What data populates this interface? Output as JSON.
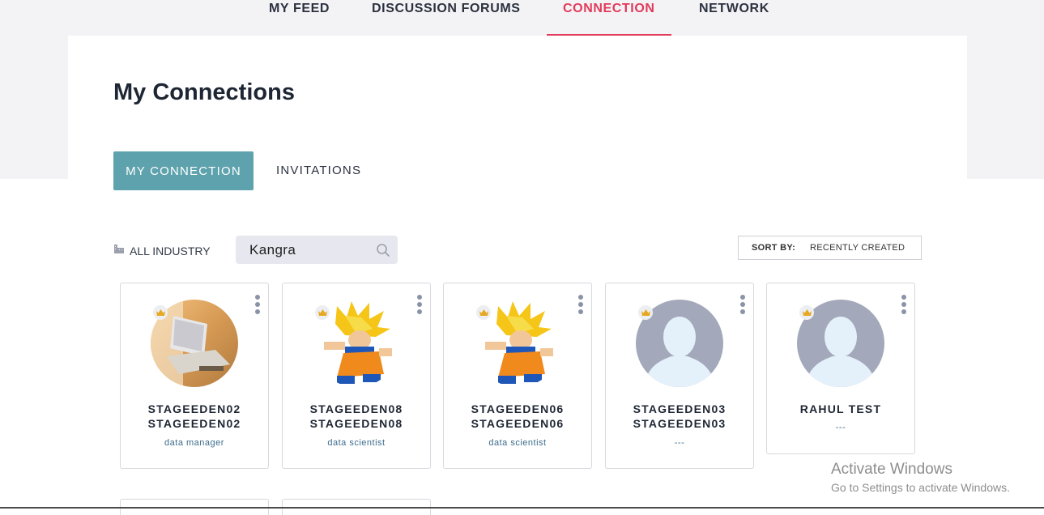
{
  "nav": {
    "items": [
      {
        "label": "MY FEED"
      },
      {
        "label": "DISCUSSION FORUMS"
      },
      {
        "label": "CONNECTION"
      },
      {
        "label": "NETWORK"
      }
    ],
    "active": "CONNECTION",
    "active_color": "#e23a5b"
  },
  "page": {
    "title": "My Connections"
  },
  "tabs": {
    "primary": "MY CONNECTION",
    "secondary": "INVITATIONS",
    "primary_color": "#5da2ac"
  },
  "filters": {
    "industry_label": "ALL INDUSTRY",
    "search_value": "Kangra",
    "sort_label": "SORT BY:",
    "sort_value": "RECENTLY CREATED"
  },
  "connections": [
    {
      "name_line1": "STAGEEDEN02",
      "name_line2": "STAGEEDEN02",
      "role": "data manager",
      "avatar": "workspace-photo"
    },
    {
      "name_line1": "STAGEEDEN08",
      "name_line2": "STAGEEDEN08",
      "role": "data scientist",
      "avatar": "anime-character"
    },
    {
      "name_line1": "STAGEEDEN06",
      "name_line2": "STAGEEDEN06",
      "role": "data scientist",
      "avatar": "anime-character"
    },
    {
      "name_line1": "STAGEEDEN03",
      "name_line2": "STAGEEDEN03",
      "role": "---",
      "avatar": "default-user"
    },
    {
      "name_line1": "RAHUL TEST",
      "name_line2": "",
      "role": "---",
      "avatar": "default-user"
    }
  ],
  "watermark": {
    "title": "Activate Windows",
    "subtitle": "Go to Settings to activate Windows."
  }
}
